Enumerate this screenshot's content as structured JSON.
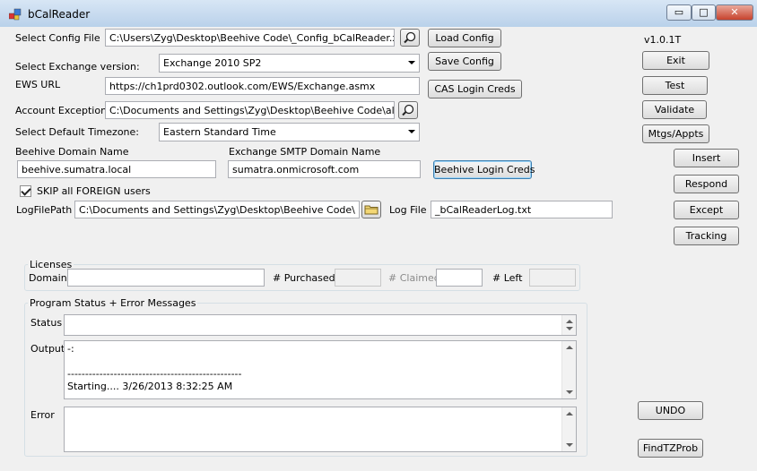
{
  "window": {
    "title": "bCalReader",
    "minimize_glyph": "▭",
    "maximize_glyph": "□",
    "close_glyph": "✕"
  },
  "version": "v1.0.1T",
  "config": {
    "config_file_label": "Select Config File",
    "config_file_value": "C:\\Users\\Zyg\\Desktop\\Beehive Code\\_Config_bCalReader.xml",
    "load_config": "Load Config",
    "exchange_version_label": "Select Exchange version:",
    "exchange_version_value": "Exchange 2010 SP2",
    "save_config": "Save Config",
    "ews_url_label": "EWS URL",
    "ews_url_value": "https://ch1prd0302.outlook.com/EWS/Exchange.asmx",
    "cas_login": "CAS Login Creds",
    "account_exceptions_label": "Account Exceptions",
    "account_exceptions_value": "C:\\Documents and Settings\\Zyg\\Desktop\\Beehive Code\\alt_acco",
    "timezone_label": "Select Default Timezone:",
    "timezone_value": "Eastern Standard Time",
    "beehive_domain_label": "Beehive Domain Name",
    "beehive_domain_value": "beehive.sumatra.local",
    "smtp_domain_label": "Exchange SMTP Domain Name",
    "smtp_domain_value": "sumatra.onmicrosoft.com",
    "beehive_login": "Beehive Login Creds",
    "skip_foreign_label": "SKIP all FOREIGN users",
    "logfile_path_label": "LogFilePath",
    "logfile_path_value": "C:\\Documents and Settings\\Zyg\\Desktop\\Beehive Code\\",
    "logfile_label": "Log File",
    "logfile_value": "_bCalReaderLog.txt"
  },
  "side_buttons": {
    "exit": "Exit",
    "test": "Test",
    "validate": "Validate",
    "mtgs": "Mtgs/Appts",
    "insert": "Insert",
    "respond": "Respond",
    "except": "Except",
    "tracking": "Tracking",
    "undo": "UNDO",
    "findtz": "FindTZProb"
  },
  "licenses": {
    "group_label": "Licenses",
    "domain_label": "Domain:",
    "domain_value": "",
    "purchased_label": "# Purchased",
    "purchased_value": "",
    "claimed_label": "# Claimed",
    "claimed_value": "",
    "left_label": "# Left",
    "left_value": ""
  },
  "status": {
    "group_label": "Program Status + Error Messages",
    "status_label": "Status",
    "status_value": "",
    "output_label": "Output",
    "output_value": "-:\n\n-------------------------------------------------\nStarting.... 3/26/2013 8:32:25 AM",
    "error_label": "Error",
    "error_value": ""
  },
  "icons": {
    "app": "calendar-app-icon",
    "browse_config": "search-icon",
    "browse_exceptions": "search-icon",
    "browse_folder": "folder-icon"
  },
  "colors": {
    "titlebar": "#c4d8ee",
    "close_button": "#c7422d",
    "focus_border": "#3c7fb1"
  }
}
